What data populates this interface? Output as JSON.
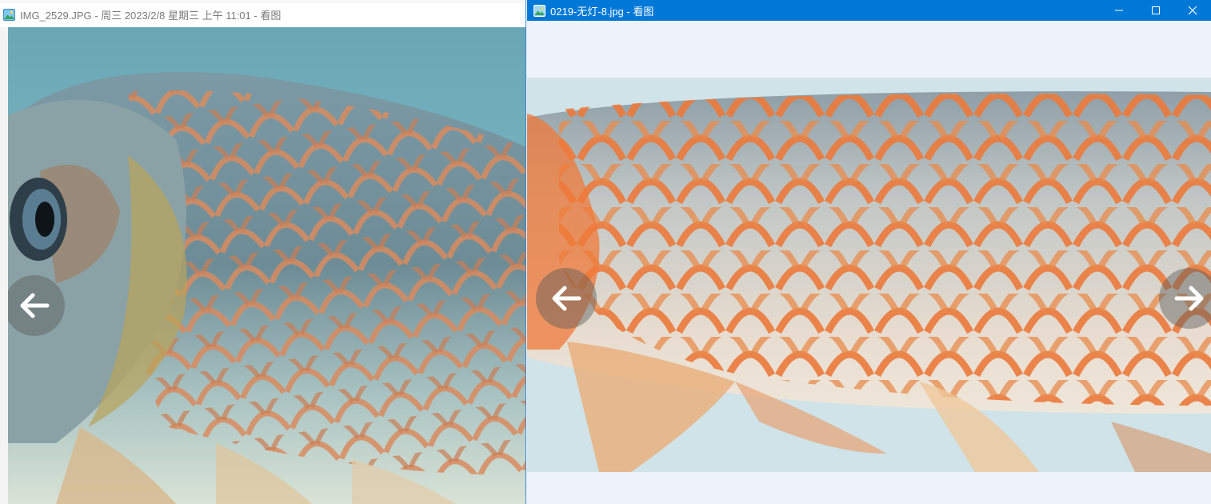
{
  "left_window": {
    "title": "IMG_2529.JPG - 周三 2023/2/8 星期三 上午 11:01 - 看图",
    "app_icon": "image-viewer-icon",
    "nav": {
      "prev_icon": "arrow-left-icon"
    }
  },
  "right_window": {
    "title": "0219-无灯-8.jpg - 看图",
    "app_icon": "image-viewer-icon",
    "controls": [
      "minimize-icon",
      "maximize-icon",
      "close-icon"
    ],
    "nav": {
      "prev_icon": "arrow-left-icon",
      "next_icon": "arrow-right-icon"
    }
  },
  "colors": {
    "titlebar_active": "#0078d7",
    "titlebar_inactive": "#ffffff",
    "viewer_background": "#eef2f9",
    "nav_button": "#5a5a5a"
  }
}
